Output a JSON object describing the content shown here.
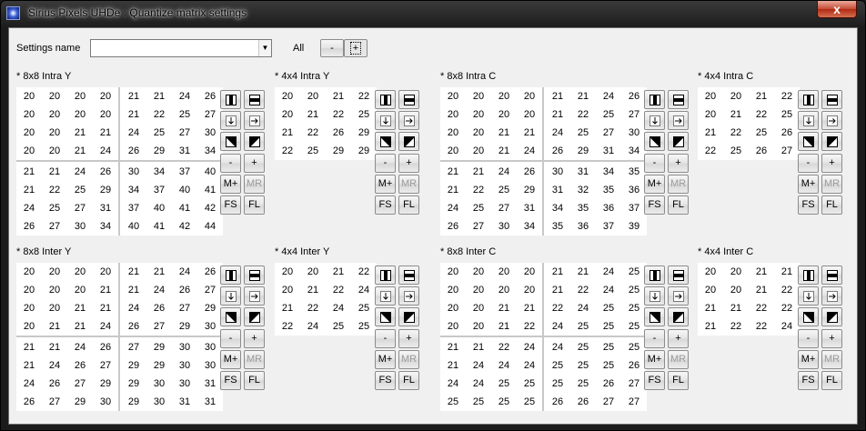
{
  "window": {
    "title": "Sirius Pixels UHDe : Quantize matrix settings",
    "close_label": "x"
  },
  "settings": {
    "label": "Settings name",
    "value": "",
    "all_label": "All",
    "minus_label": "-",
    "plus_label": "+"
  },
  "tools": {
    "minus": "-",
    "plus": "+",
    "mplus": "M+",
    "mr": "MR",
    "fs": "FS",
    "fl": "FL"
  },
  "matrices": [
    {
      "title": "* 8x8 Intra Y",
      "size": 8,
      "values": [
        [
          20,
          20,
          20,
          20,
          21,
          21,
          24,
          26
        ],
        [
          20,
          20,
          20,
          20,
          21,
          22,
          25,
          27
        ],
        [
          20,
          20,
          21,
          21,
          24,
          25,
          27,
          30
        ],
        [
          20,
          20,
          21,
          24,
          26,
          29,
          31,
          34
        ],
        [
          21,
          21,
          24,
          26,
          30,
          34,
          37,
          40
        ],
        [
          21,
          22,
          25,
          29,
          34,
          37,
          40,
          41
        ],
        [
          24,
          25,
          27,
          31,
          37,
          40,
          41,
          42
        ],
        [
          26,
          27,
          30,
          34,
          40,
          41,
          42,
          44
        ]
      ]
    },
    {
      "title": "* 4x4 Intra Y",
      "size": 4,
      "values": [
        [
          20,
          20,
          21,
          22
        ],
        [
          20,
          21,
          22,
          25
        ],
        [
          21,
          22,
          26,
          29
        ],
        [
          22,
          25,
          29,
          29
        ]
      ]
    },
    {
      "title": "* 8x8 Intra C",
      "size": 8,
      "values": [
        [
          20,
          20,
          20,
          20,
          21,
          21,
          24,
          26
        ],
        [
          20,
          20,
          20,
          20,
          21,
          22,
          25,
          27
        ],
        [
          20,
          20,
          21,
          21,
          24,
          25,
          27,
          30
        ],
        [
          20,
          20,
          21,
          24,
          26,
          29,
          31,
          34
        ],
        [
          21,
          21,
          24,
          26,
          30,
          31,
          34,
          35
        ],
        [
          21,
          22,
          25,
          29,
          31,
          32,
          35,
          36
        ],
        [
          24,
          25,
          27,
          31,
          34,
          35,
          36,
          37
        ],
        [
          26,
          27,
          30,
          34,
          35,
          36,
          37,
          39
        ]
      ]
    },
    {
      "title": "* 4x4 Intra C",
      "size": 4,
      "values": [
        [
          20,
          20,
          21,
          22
        ],
        [
          20,
          21,
          22,
          25
        ],
        [
          21,
          22,
          25,
          26
        ],
        [
          22,
          25,
          26,
          27
        ]
      ]
    },
    {
      "title": "* 8x8 Inter Y",
      "size": 8,
      "values": [
        [
          20,
          20,
          20,
          20,
          21,
          21,
          24,
          26
        ],
        [
          20,
          20,
          20,
          21,
          21,
          24,
          26,
          27
        ],
        [
          20,
          20,
          21,
          21,
          24,
          26,
          27,
          29
        ],
        [
          20,
          21,
          21,
          24,
          26,
          27,
          29,
          30
        ],
        [
          21,
          21,
          24,
          26,
          27,
          29,
          30,
          30
        ],
        [
          21,
          24,
          26,
          27,
          29,
          29,
          30,
          30
        ],
        [
          24,
          26,
          27,
          29,
          29,
          30,
          30,
          31
        ],
        [
          26,
          27,
          29,
          30,
          29,
          30,
          31,
          31
        ]
      ]
    },
    {
      "title": "* 4x4 Inter Y",
      "size": 4,
      "values": [
        [
          20,
          20,
          21,
          22
        ],
        [
          20,
          21,
          22,
          24
        ],
        [
          21,
          22,
          24,
          25
        ],
        [
          22,
          24,
          25,
          25
        ]
      ]
    },
    {
      "title": "* 8x8 Inter C",
      "size": 8,
      "values": [
        [
          20,
          20,
          20,
          20,
          21,
          21,
          24,
          25
        ],
        [
          20,
          20,
          20,
          20,
          21,
          22,
          24,
          25
        ],
        [
          20,
          20,
          21,
          21,
          22,
          24,
          25,
          25
        ],
        [
          20,
          20,
          21,
          22,
          24,
          25,
          25,
          25
        ],
        [
          21,
          21,
          22,
          24,
          24,
          25,
          25,
          25
        ],
        [
          21,
          24,
          24,
          24,
          25,
          25,
          25,
          26
        ],
        [
          24,
          24,
          25,
          25,
          25,
          25,
          26,
          27
        ],
        [
          25,
          25,
          25,
          25,
          26,
          26,
          27,
          27
        ]
      ]
    },
    {
      "title": "* 4x4 Inter C",
      "size": 4,
      "values": [
        [
          20,
          20,
          21,
          21
        ],
        [
          20,
          20,
          21,
          22
        ],
        [
          21,
          21,
          22,
          22
        ],
        [
          21,
          22,
          22,
          24
        ]
      ]
    }
  ]
}
